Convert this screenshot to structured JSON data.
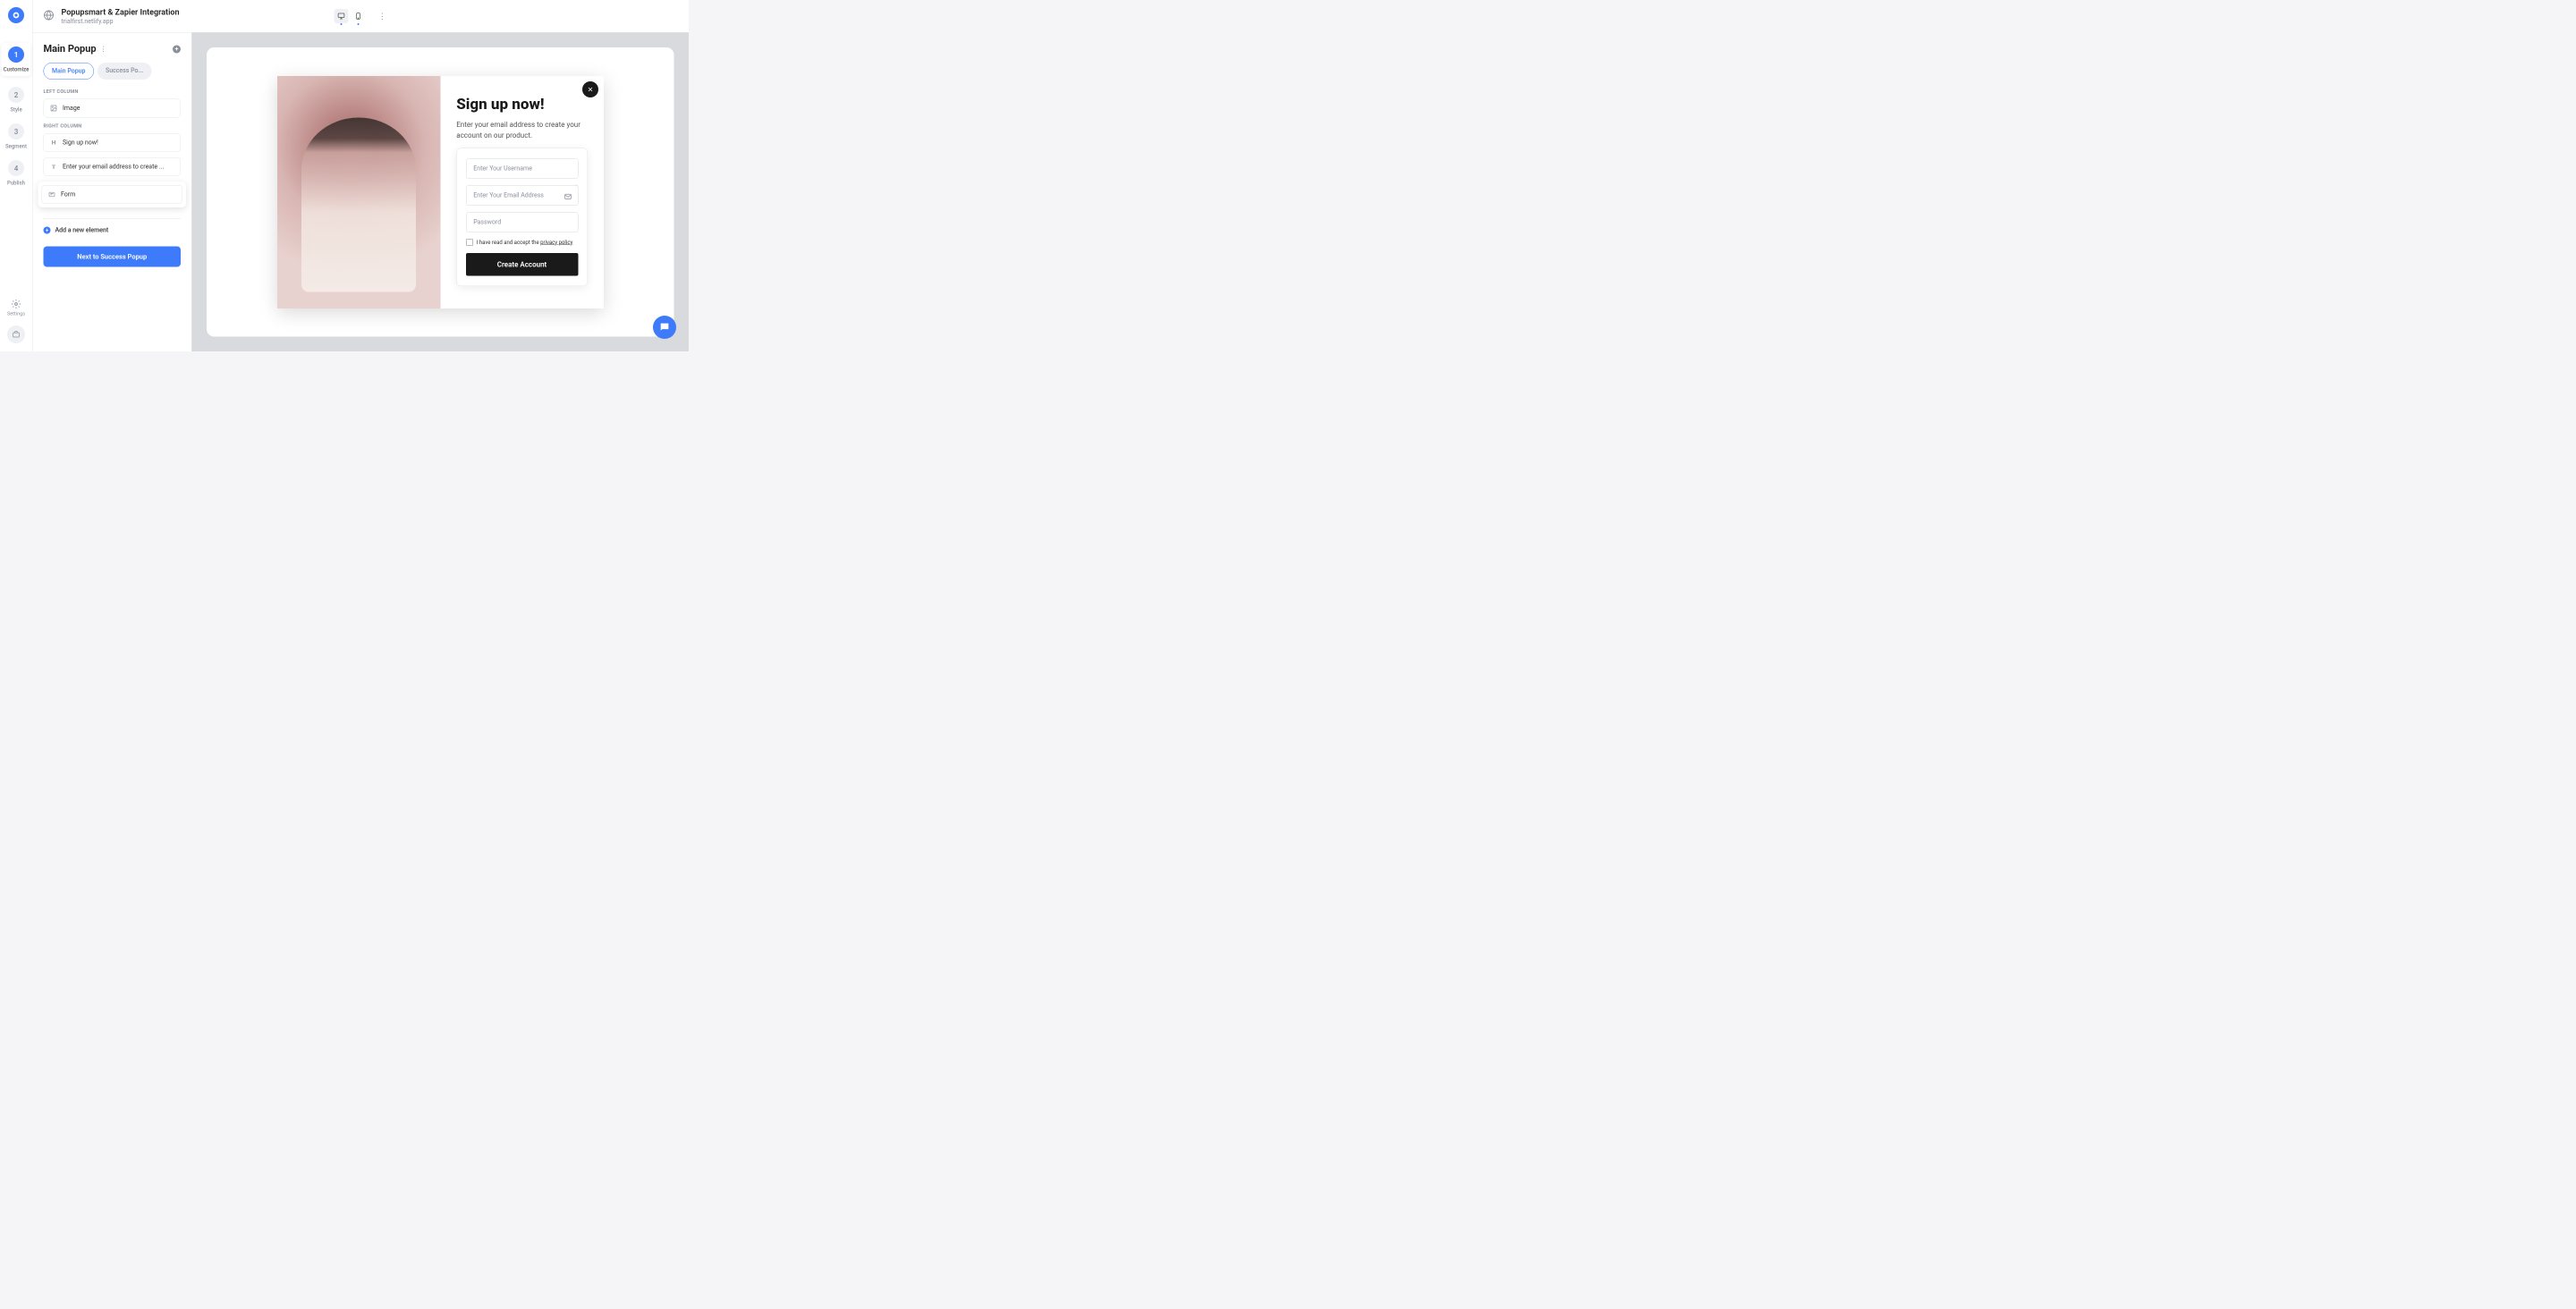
{
  "header": {
    "title": "Popupsmart & Zapier Integration",
    "subtitle": "trialfirst.netlify.app"
  },
  "steps": {
    "s1": {
      "num": "1",
      "label": "Customize"
    },
    "s2": {
      "num": "2",
      "label": "Style"
    },
    "s3": {
      "num": "3",
      "label": "Segment"
    },
    "s4": {
      "num": "4",
      "label": "Publish"
    },
    "settings": "Settings"
  },
  "panel": {
    "title": "Main Popup",
    "tabs": {
      "main": "Main Popup",
      "success": "Success Po..."
    },
    "left_column_label": "LEFT COLUMN",
    "right_column_label": "RIGHT COLUMN",
    "items": {
      "image": "Image",
      "heading": "Sign up now!",
      "text": "Enter your email address to create ...",
      "form": "Form"
    },
    "add_element": "Add a new element",
    "next_button": "Next to Success Popup"
  },
  "popup": {
    "heading": "Sign up now!",
    "subheading": "Enter your email address to create your account on our product.",
    "username_placeholder": "Enter Your Username",
    "email_placeholder": "Enter Your Email Address",
    "password_placeholder": "Password",
    "checkbox_text_prefix": "I have read and accept the ",
    "checkbox_link": "privacy policy",
    "submit": "Create Account"
  }
}
